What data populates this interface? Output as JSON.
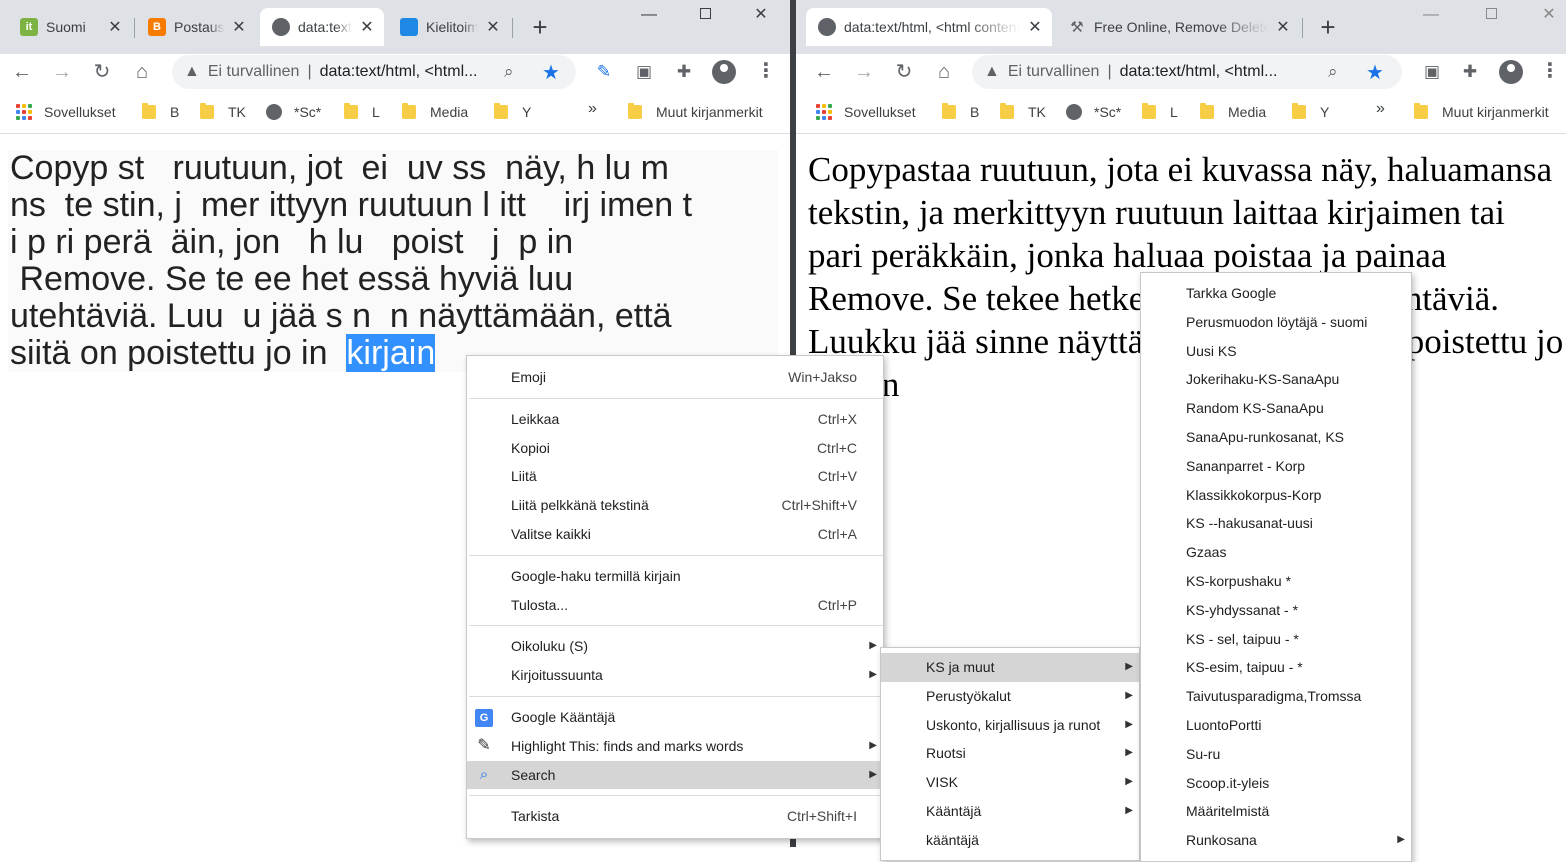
{
  "left_window": {
    "tabs": [
      {
        "title": "Suomi",
        "favicon": "itf-icon",
        "color": "#7cb342"
      },
      {
        "title": "Postaus",
        "favicon": "blogger-icon",
        "color": "#f57c00"
      },
      {
        "title": "data:text",
        "favicon": "globe-icon",
        "color": "#5f6368"
      },
      {
        "title": "Kielitoimisto",
        "favicon": "book-icon",
        "color": "#1e88e5"
      }
    ],
    "omnibox": {
      "security": "Ei turvallinen",
      "url": "data:text/html, <html"
    },
    "bookmarks": [
      "Sovellukset",
      "B",
      "TK",
      "*Sc*",
      "L",
      "Media",
      "Y"
    ],
    "bookmarks_more": "»",
    "other_bookmarks": "Muut kirjanmerkit",
    "content_lines": [
      "Copyp st   ruutuun, jot  ei  uv ss  näy, h lu m",
      "ns  te stin, j  mer ittyyn ruutuun l itt    irj imen t",
      "i p ri perä  äin, jon   h lu   poist   j  p in",
      " Remove. Se te ee het essä hyviä luu",
      "utehtäviä. Luu  u jää s n  n näyttämään, että"
    ],
    "last_line_prefix": "siitä on poistettu jo in  ",
    "selection": "kirjain"
  },
  "right_window": {
    "tabs": [
      {
        "title": "data:text/html, <html contenteditable>",
        "favicon": "globe-icon",
        "color": "#5f6368"
      },
      {
        "title": "Free Online, Remove Delete",
        "favicon": "tools-icon",
        "color": "#5f6368"
      }
    ],
    "omnibox": {
      "security": "Ei turvallinen",
      "url": "data:text/html, <html"
    },
    "bookmarks": [
      "Sovellukset",
      "B",
      "TK",
      "*Sc*",
      "L",
      "Media",
      "Y"
    ],
    "bookmarks_more": "»",
    "other_bookmarks": "Muut kirjanmerkit",
    "content": "Copypastaa ruutuun, jota ei kuvassa näy, haluamansa tekstin, ja merkittyyn ruutuun laittaa kirjaimen tai pari peräkkäin, jonka haluaa poistaa ja painaa Remove. Se tekee hetkessä hyviä luukkutehtäviä. Luukku jää sinne näyttämään, että siitä on poistettu jo kirjain"
  },
  "context_menu": {
    "groups": [
      [
        {
          "label": "Emoji",
          "shortcut": "Win+Jakso"
        }
      ],
      [
        {
          "label": "Leikkaa",
          "shortcut": "Ctrl+X"
        },
        {
          "label": "Kopioi",
          "shortcut": "Ctrl+C"
        },
        {
          "label": "Liitä",
          "shortcut": "Ctrl+V"
        },
        {
          "label": "Liitä pelkkänä tekstinä",
          "shortcut": "Ctrl+Shift+V"
        },
        {
          "label": "Valitse kaikki",
          "shortcut": "Ctrl+A"
        }
      ],
      [
        {
          "label": "Google-haku termillä kirjain",
          "shortcut": ""
        },
        {
          "label": "Tulosta...",
          "shortcut": "Ctrl+P"
        }
      ],
      [
        {
          "label": "Oikoluku (S)",
          "shortcut": "",
          "submenu": true
        },
        {
          "label": "Kirjoitussuunta",
          "shortcut": "",
          "submenu": true
        }
      ],
      [
        {
          "label": "Google Kääntäjä",
          "shortcut": "",
          "icon": "google-translate-icon"
        },
        {
          "label": "Highlight This: finds and marks words",
          "shortcut": "",
          "icon": "highlighter-icon",
          "submenu": true
        },
        {
          "label": "Search",
          "shortcut": "",
          "icon": "search-extension-icon",
          "submenu": true,
          "highlighted": true
        }
      ],
      [
        {
          "label": "Tarkista",
          "shortcut": "Ctrl+Shift+I"
        }
      ]
    ]
  },
  "search_submenu": [
    {
      "label": "KS ja muut",
      "submenu": true,
      "highlighted": true
    },
    {
      "label": "Perustyökalut",
      "submenu": true
    },
    {
      "label": "Uskonto, kirjallisuus ja runot",
      "submenu": true
    },
    {
      "label": "Ruotsi",
      "submenu": true
    },
    {
      "label": "VISK",
      "submenu": true
    },
    {
      "label": "Kääntäjä",
      "submenu": true
    },
    {
      "label": "kääntäjä",
      "submenu": false
    }
  ],
  "ks_submenu": [
    {
      "label": "Tarkka Google"
    },
    {
      "label": "Perusmuodon löytäjä - suomi"
    },
    {
      "label": "Uusi KS"
    },
    {
      "label": "Jokerihaku-KS-SanaApu"
    },
    {
      "label": "Random KS-SanaApu"
    },
    {
      "label": "SanaApu-runkosanat, KS"
    },
    {
      "label": "Sananparret - Korp"
    },
    {
      "label": "Klassikkokorpus-Korp"
    },
    {
      "label": "KS --hakusanat-uusi"
    },
    {
      "label": "Gzaas"
    },
    {
      "label": "KS-korpushaku *"
    },
    {
      "label": "KS-yhdyssanat  - *"
    },
    {
      "label": "KS - sel, taipuu - *"
    },
    {
      "label": "KS-esim, taipuu - *"
    },
    {
      "label": "Taivutusparadigma,Tromssa"
    },
    {
      "label": "LuontoPortti"
    },
    {
      "label": "Su-ru"
    },
    {
      "label": "Scoop.it-yleis"
    },
    {
      "label": "Määritelmistä"
    },
    {
      "label": "Runkosana",
      "submenu": true
    }
  ]
}
